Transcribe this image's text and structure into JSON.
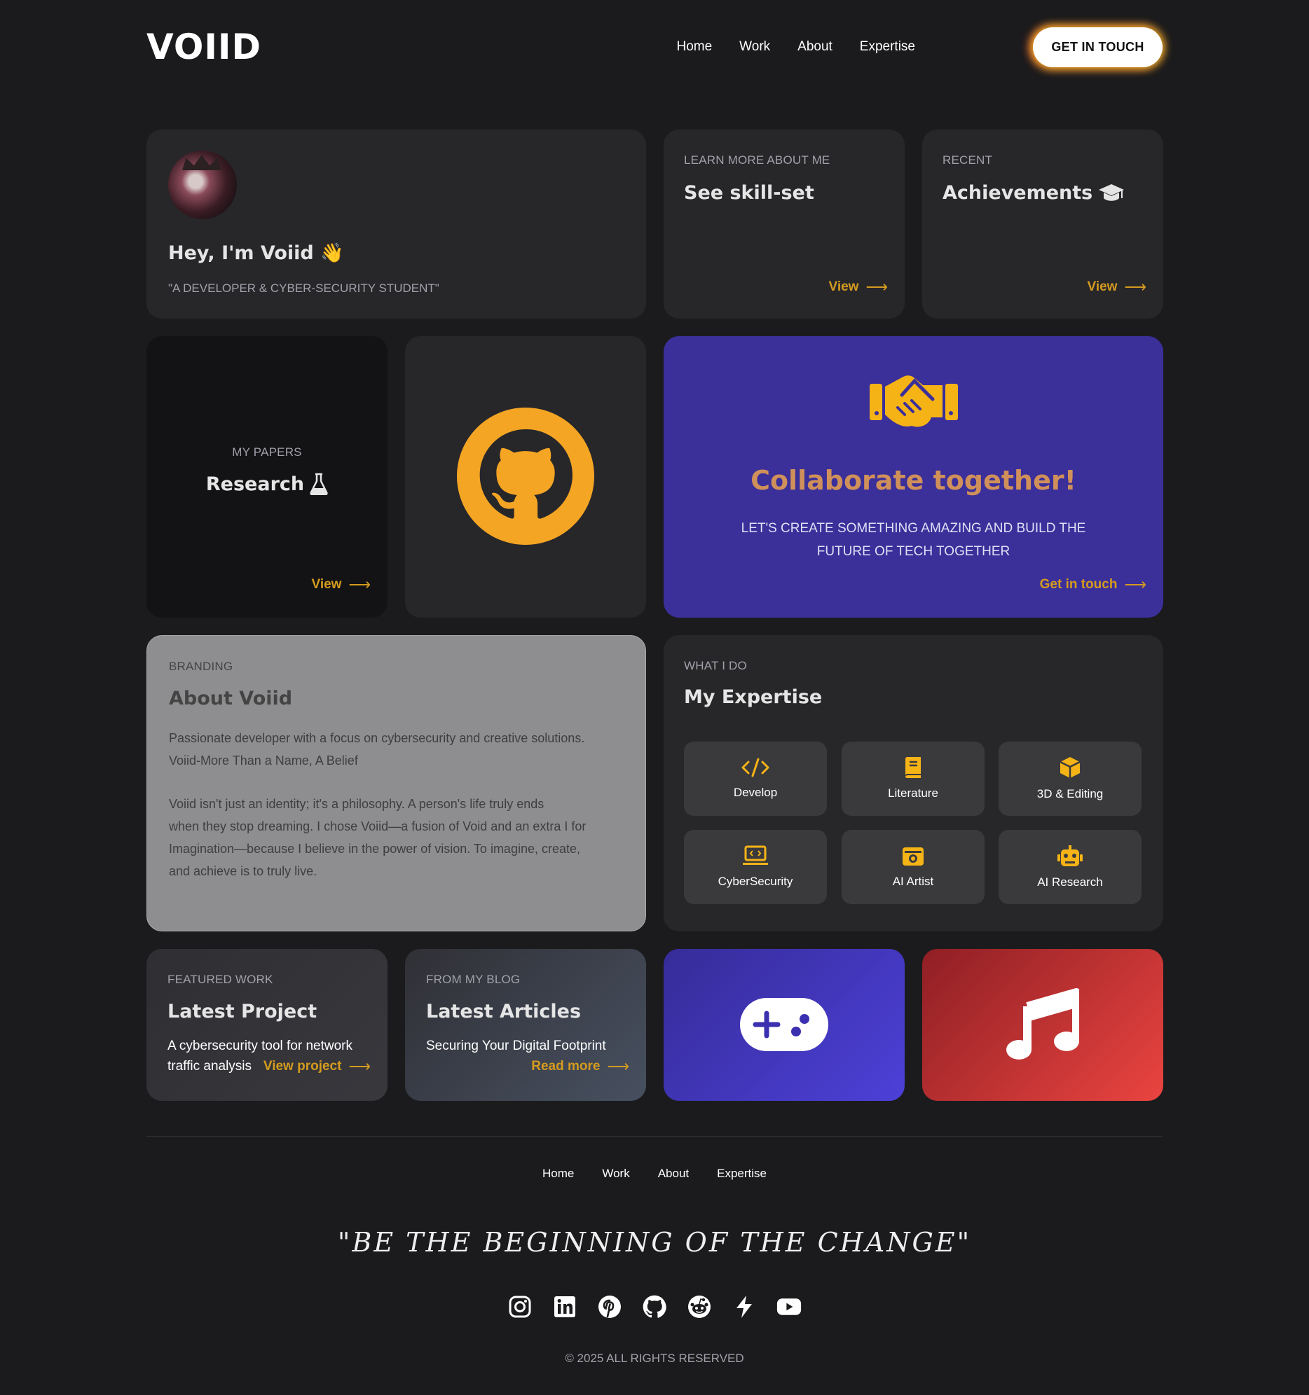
{
  "header": {
    "logo": "VOIID",
    "nav": [
      "Home",
      "Work",
      "About",
      "Expertise"
    ],
    "cta": "GET IN TOUCH"
  },
  "intro": {
    "greeting": "Hey, I'm Voiid 👋",
    "tagline": "\"A DEVELOPER & CYBER-SECURITY STUDENT\""
  },
  "skills": {
    "eyebrow": "LEARN MORE ABOUT ME",
    "title": "See skill-set",
    "link": "View"
  },
  "achievements": {
    "eyebrow": "RECENT",
    "title": "Achievements",
    "link": "View"
  },
  "research": {
    "eyebrow": "MY PAPERS",
    "title": "Research",
    "link": "View"
  },
  "collab": {
    "title": "Collaborate together!",
    "line1": "LET'S CREATE SOMETHING AMAZING AND BUILD THE",
    "line2": "FUTURE OF TECH TOGETHER",
    "link": "Get in touch"
  },
  "about": {
    "eyebrow": "BRANDING",
    "title": "About Voiid",
    "p1a": "Passionate developer with a focus on cybersecurity and creative solutions.",
    "p1b": "Voiid-More Than a Name, A Belief",
    "p2a": "Voiid isn't just an identity; it's a philosophy. A person's life truly ends",
    "p2b": "when they stop dreaming. I chose Voiid—a fusion of Void and an extra I for",
    "p2c": "Imagination—because I believe in the power of vision. To imagine, create,",
    "p2d": "and achieve is to truly live."
  },
  "expertise": {
    "eyebrow": "WHAT I DO",
    "title": "My Expertise",
    "items": [
      "Develop",
      "Literature",
      "3D & Editing",
      "CyberSecurity",
      "AI Artist",
      "AI Research"
    ]
  },
  "project": {
    "eyebrow": "FEATURED WORK",
    "title": "Latest Project",
    "desc1": "A cybersecurity tool for network",
    "desc2": "traffic analysis",
    "link": "View project"
  },
  "blog": {
    "eyebrow": "FROM MY BLOG",
    "title": "Latest Articles",
    "desc": "Securing Your Digital Footprint",
    "link": "Read more"
  },
  "footer": {
    "nav": [
      "Home",
      "Work",
      "About",
      "Expertise"
    ],
    "quote": "\"BE THE BEGINNING OF THE CHANGE\"",
    "social_icons": [
      "instagram-icon",
      "linkedin-icon",
      "pinterest-icon",
      "github-icon",
      "reddit-icon",
      "bolt-icon",
      "youtube-icon"
    ],
    "copyright": "© 2025 ALL RIGHTS RESERVED"
  },
  "colors": {
    "background": "#1b1b1d",
    "card": "#27272a",
    "accent": "#d49b1f",
    "collab": "#3b2f9a",
    "game": "#4338ca",
    "music": "#dc2626"
  }
}
